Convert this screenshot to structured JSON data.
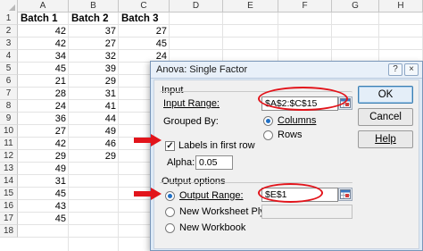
{
  "sheet": {
    "columns": [
      "A",
      "B",
      "C",
      "D",
      "E",
      "F",
      "G",
      "H"
    ],
    "rows": [
      "1",
      "2",
      "3",
      "4",
      "5",
      "6",
      "7",
      "8",
      "9",
      "10",
      "11",
      "12",
      "13",
      "14",
      "15",
      "16",
      "17",
      "18"
    ],
    "headers": [
      "Batch 1",
      "Batch 2",
      "Batch 3"
    ],
    "batch1": [
      "42",
      "42",
      "34",
      "45",
      "21",
      "28",
      "24",
      "36",
      "27",
      "42",
      "29",
      "49",
      "31",
      "45",
      "43",
      "45"
    ],
    "batch2": [
      "37",
      "27",
      "32",
      "39",
      "29",
      "31",
      "41",
      "44",
      "49",
      "46",
      "29"
    ],
    "batch3": [
      "27",
      "45",
      "24"
    ]
  },
  "dialog": {
    "title": "Anova: Single Factor",
    "help_glyph": "?",
    "close_glyph": "×",
    "input_group": "Input",
    "input_range_label": "Input Range:",
    "input_range_value": "$A$2:$C$15",
    "grouped_by_label": "Grouped By:",
    "columns_label": "Columns",
    "rows_label": "Rows",
    "labels_first_row": "Labels in first row",
    "alpha_label": "Alpha:",
    "alpha_value": "0.05",
    "output_group": "Output options",
    "output_range_label": "Output Range:",
    "output_range_value": "$E$1",
    "new_ply_label": "New Worksheet Ply:",
    "new_workbook_label": "New Workbook",
    "ok_label": "OK",
    "cancel_label": "Cancel",
    "help_label": "Help"
  },
  "colors": {
    "annotation": "#e2141b",
    "dialog_bg": "#ddeaf7",
    "radio_dot": "#1f6fc5"
  },
  "icons": {
    "ref": "range-selector-icon",
    "arrow": "arrow-right-icon"
  }
}
